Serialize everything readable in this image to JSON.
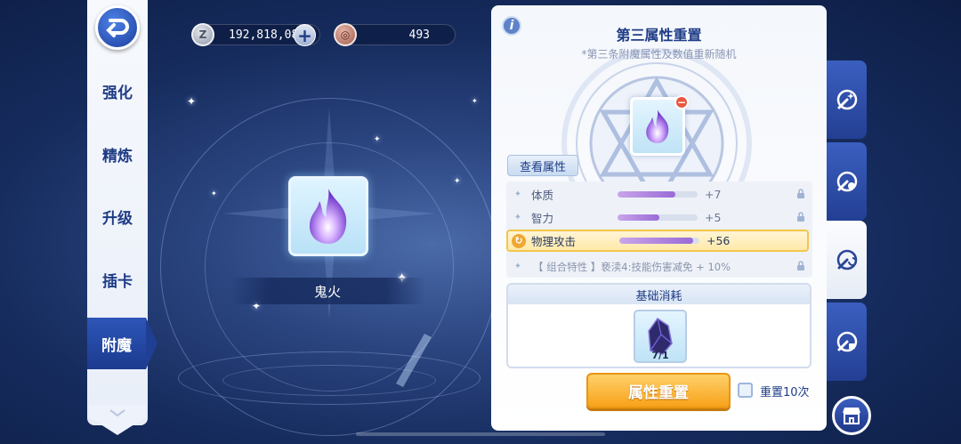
{
  "currency": {
    "zeny_icon": "zeny-coin-icon",
    "zeny_amount": "192,818,086",
    "token_icon": "token-coin-icon",
    "token_amount": "493"
  },
  "menu": {
    "items": [
      {
        "label": "强化",
        "active": false
      },
      {
        "label": "精炼",
        "active": false
      },
      {
        "label": "升级",
        "active": false
      },
      {
        "label": "插卡",
        "active": false
      },
      {
        "label": "附魔",
        "active": true
      }
    ]
  },
  "item": {
    "name": "鬼火",
    "icon": "purple-flame-icon"
  },
  "panel": {
    "title": "第三属性重置",
    "subtitle": "*第三条附魔属性及数值重新随机",
    "view_attr_label": "查看属性",
    "attributes": [
      {
        "name": "体质",
        "value": "+7",
        "fill": 0.72,
        "locked": true,
        "highlight": false
      },
      {
        "name": "智力",
        "value": "+5",
        "fill": 0.52,
        "locked": true,
        "highlight": false
      },
      {
        "name": "物理攻击",
        "value": "+56",
        "fill": 0.92,
        "locked": false,
        "highlight": true
      }
    ],
    "combo": "【 组合特性 】亵渎4:技能伤害减免 + 10%",
    "cost_title": "基础消耗",
    "cost_item": {
      "icon": "dark-crystal-icon",
      "count": "7/1"
    },
    "reset_label": "属性重置",
    "reset10_label": "重置10次",
    "reset10_checked": false
  },
  "right_tabs": [
    {
      "icon": "enchant-tab-1-icon",
      "active": false
    },
    {
      "icon": "enchant-tab-2-icon",
      "active": false
    },
    {
      "icon": "enchant-tab-3-icon",
      "active": true
    },
    {
      "icon": "enchant-tab-4-icon",
      "active": false
    }
  ],
  "colors": {
    "accent": "#1f3c86",
    "button_orange": "#f7a21b",
    "highlight_border": "#f3c64a",
    "bar_fill": "#9a6ad7"
  }
}
